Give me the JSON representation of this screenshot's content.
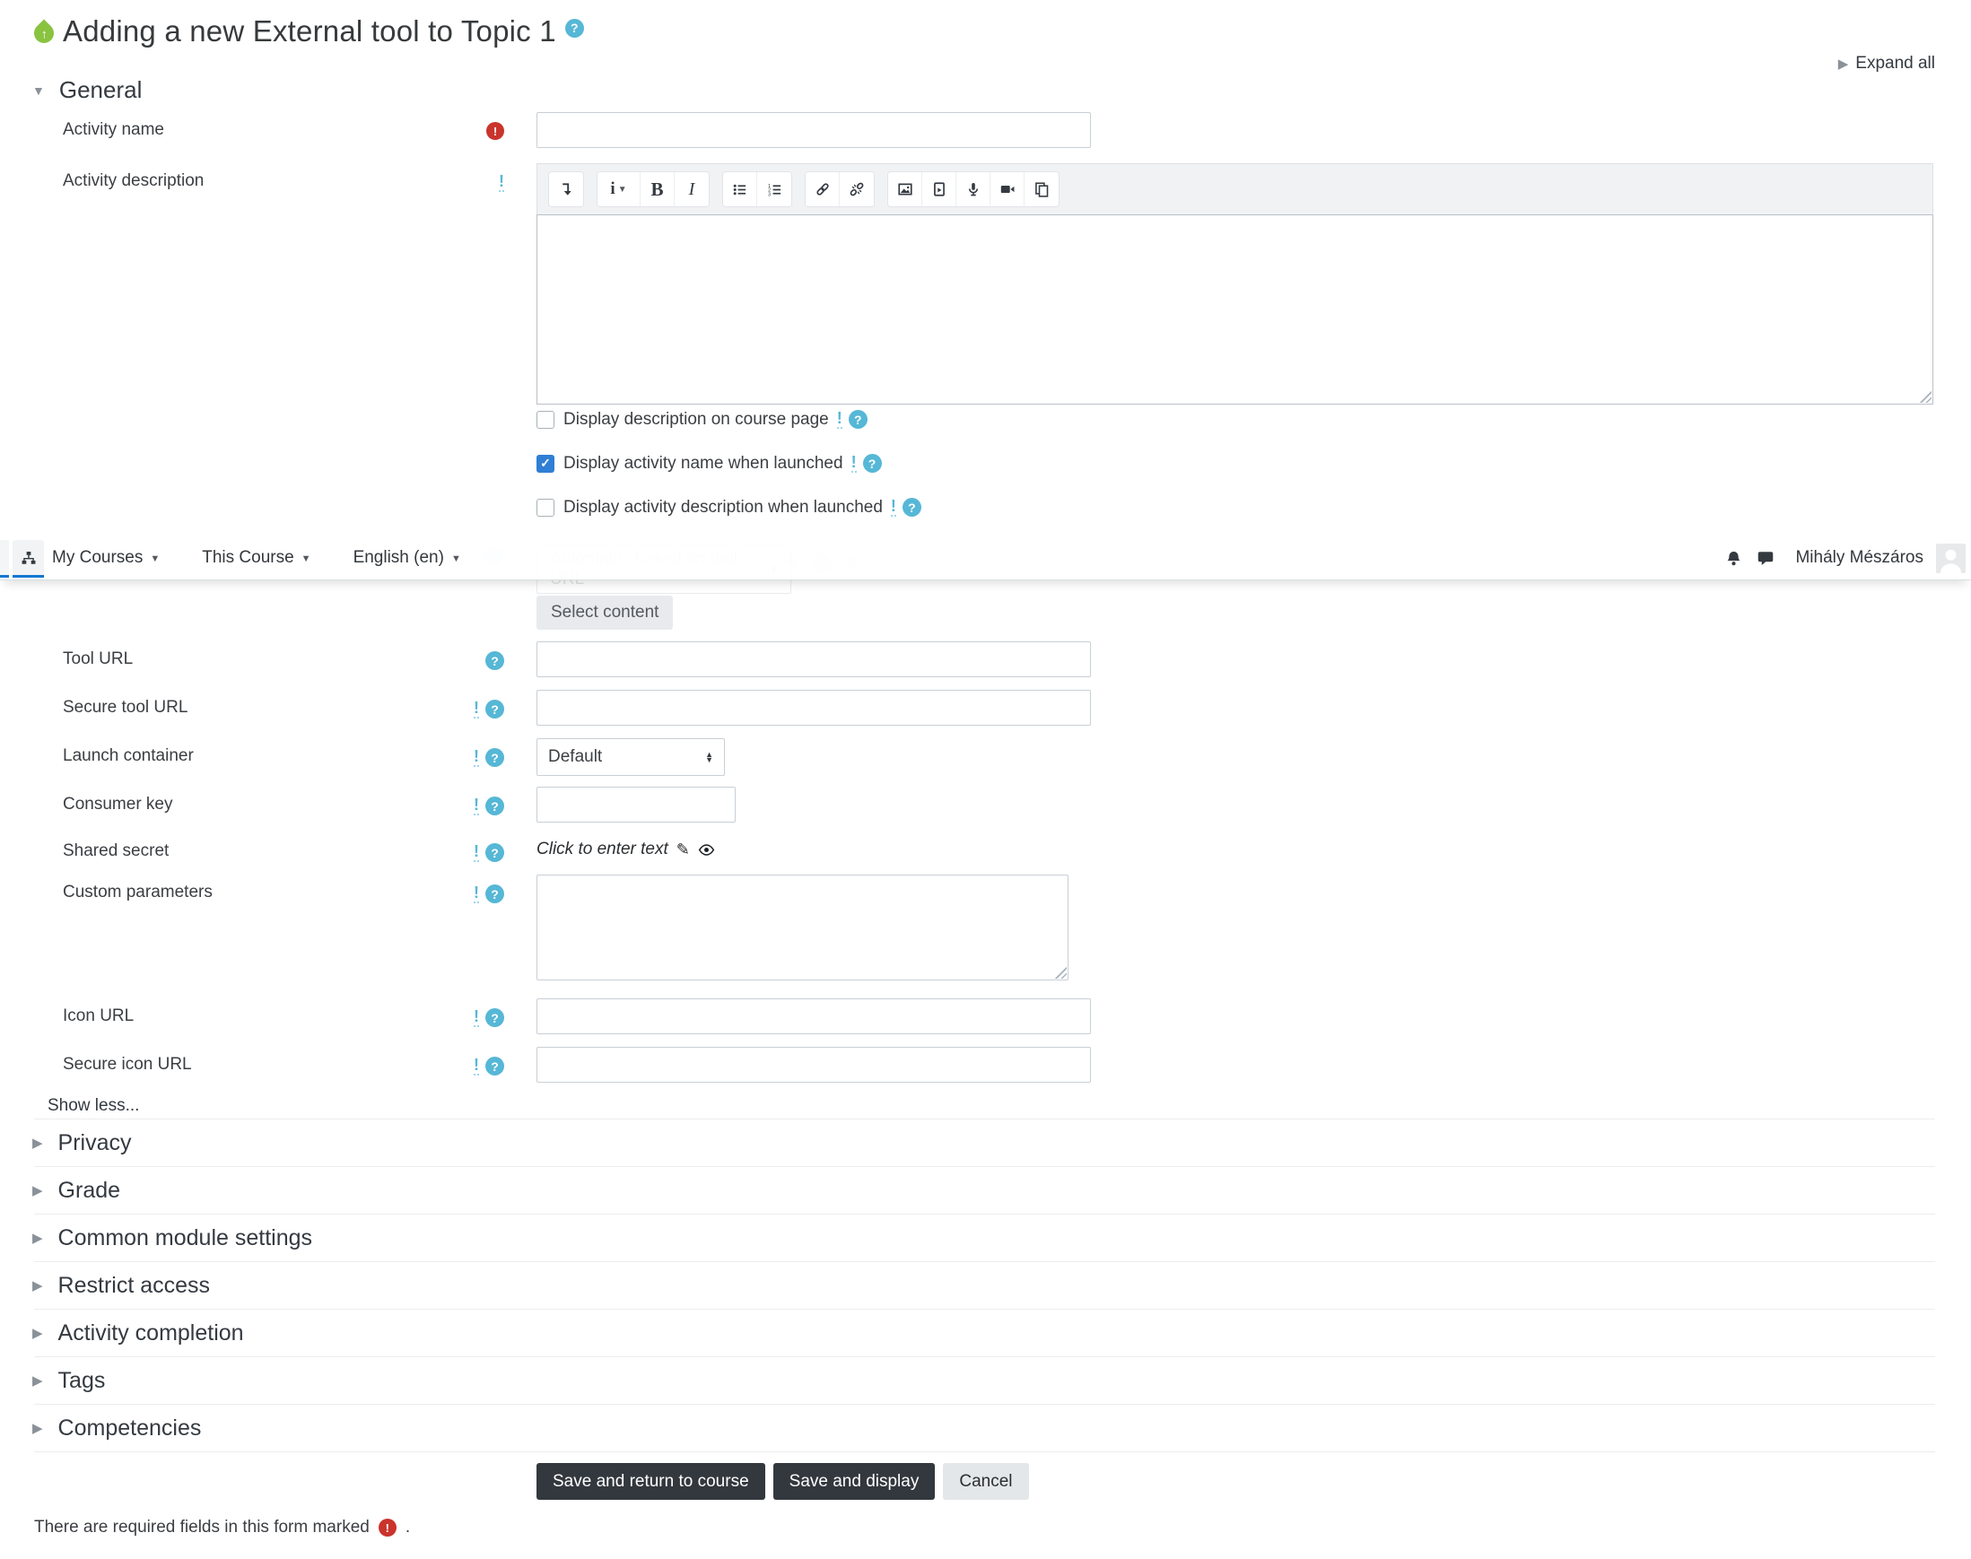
{
  "header": {
    "title": "Adding a new External tool to Topic 1",
    "expand_all": "Expand all"
  },
  "navbar": {
    "menus": [
      {
        "label": "My Courses"
      },
      {
        "label": "This Course"
      },
      {
        "label": "English (en)"
      }
    ],
    "user_name": "Mihály Mészáros",
    "icons": [
      "sitemap-icon",
      "bell-icon",
      "chat-icon",
      "avatar"
    ]
  },
  "sections": {
    "general": {
      "title": "General"
    },
    "collapsed": [
      {
        "title": "Privacy"
      },
      {
        "title": "Grade"
      },
      {
        "title": "Common module settings"
      },
      {
        "title": "Restrict access"
      },
      {
        "title": "Activity completion"
      },
      {
        "title": "Tags"
      },
      {
        "title": "Competencies"
      }
    ]
  },
  "fields": {
    "activity_name": {
      "label": "Activity name",
      "value": "",
      "required": true
    },
    "activity_description": {
      "label": "Activity description",
      "value": ""
    },
    "preconfigured_tool": {
      "select_value": "Automatic, based on tool URL"
    },
    "select_content": {
      "label": "Select content"
    },
    "tool_url": {
      "label": "Tool URL",
      "value": ""
    },
    "secure_tool_url": {
      "label": "Secure tool URL",
      "value": ""
    },
    "launch_container": {
      "label": "Launch container",
      "value": "Default"
    },
    "consumer_key": {
      "label": "Consumer key",
      "value": ""
    },
    "shared_secret": {
      "label": "Shared secret",
      "placeholder": "Click to enter text"
    },
    "custom_parameters": {
      "label": "Custom parameters",
      "value": ""
    },
    "icon_url": {
      "label": "Icon URL",
      "value": ""
    },
    "secure_icon_url": {
      "label": "Secure icon URL",
      "value": ""
    }
  },
  "checkboxes": [
    {
      "label": "Display description on course page",
      "checked": false
    },
    {
      "label": "Display activity name when launched",
      "checked": true
    },
    {
      "label": "Display activity description when launched",
      "checked": false
    }
  ],
  "editor": {
    "buttons": [
      {
        "name": "toolbar-toggle"
      },
      {
        "name": "paragraph-styles",
        "label": "i"
      },
      {
        "name": "bold",
        "label": "B"
      },
      {
        "name": "italic",
        "label": "I"
      },
      {
        "name": "unordered-list"
      },
      {
        "name": "ordered-list"
      },
      {
        "name": "link"
      },
      {
        "name": "unlink"
      },
      {
        "name": "insert-image"
      },
      {
        "name": "insert-media"
      },
      {
        "name": "record-audio"
      },
      {
        "name": "record-video"
      },
      {
        "name": "manage-files"
      }
    ]
  },
  "misc": {
    "show_less": "Show less...",
    "ghost_icons": [
      "add",
      "gear",
      "delete"
    ]
  },
  "actions": {
    "save_return": "Save and return to course",
    "save_display": "Save and display",
    "cancel": "Cancel"
  },
  "footer": {
    "required_note": "There are required fields in this form marked",
    "suffix": "."
  },
  "colors": {
    "primary": "#1177d1",
    "help_blue": "#56b7d6",
    "required_red": "#c9342c",
    "checkbox_blue": "#2f7fd4",
    "button_dark": "#33383e",
    "tool_green": "#8ac340"
  }
}
